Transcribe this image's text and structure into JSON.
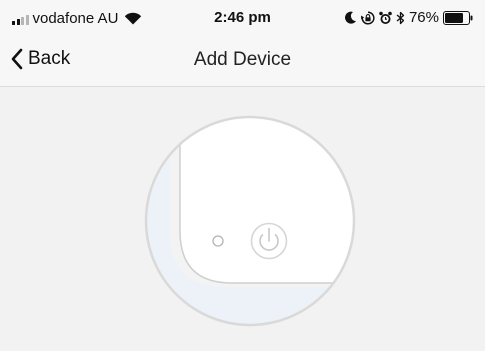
{
  "status_bar": {
    "carrier": "vodafone AU",
    "time": "2:46 pm",
    "battery": "76%",
    "icons": [
      "signal-bars-icon",
      "wifi-icon",
      "moon-icon",
      "orientation-lock-icon",
      "alarm-icon",
      "bluetooth-icon",
      "battery-icon"
    ]
  },
  "nav": {
    "back_label": "Back",
    "title": "Add Device"
  },
  "illustration": {
    "icons": [
      "power-icon",
      "indicator-light-icon"
    ]
  },
  "colors": {
    "background": "#f2f2f2",
    "bar": "#f7f7f7",
    "device": "#ffffff",
    "device_shadow": "#edf1f8",
    "outline": "#d0d0d0"
  }
}
